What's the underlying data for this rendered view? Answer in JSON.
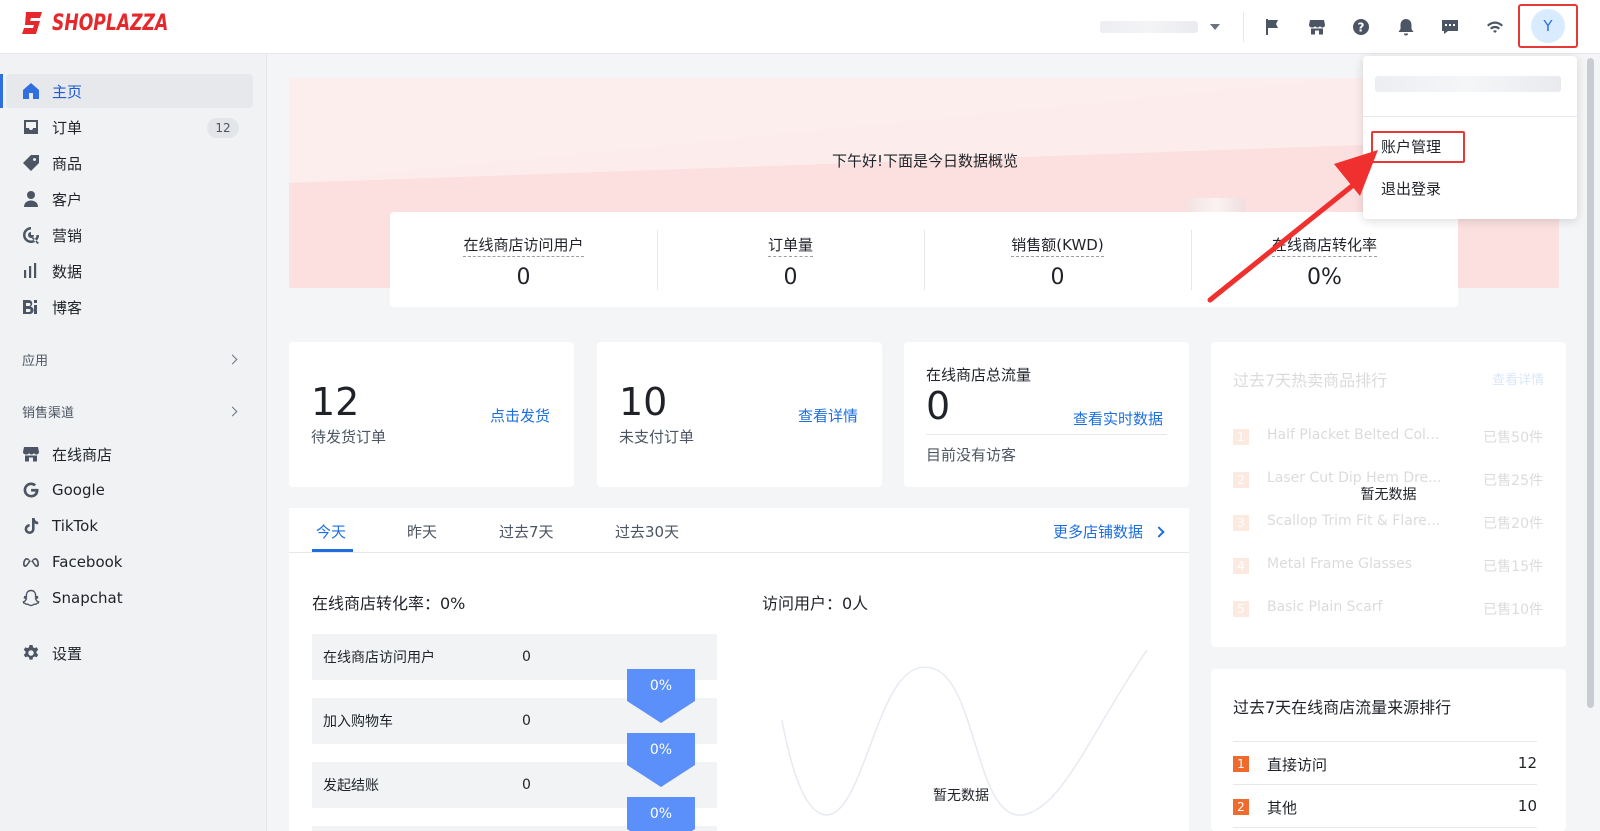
{
  "brand": {
    "name": "SHOPLAZZA",
    "color": "#e5282b"
  },
  "header": {
    "icons": [
      "flag-icon",
      "storefront-icon",
      "help-icon",
      "bell-icon",
      "message-icon",
      "wifi-icon"
    ],
    "avatar_letter": "Y"
  },
  "user_menu": {
    "items": [
      "账户管理",
      "退出登录"
    ],
    "highlighted": "账户管理"
  },
  "sidebar": {
    "items": [
      {
        "label": "主页",
        "icon": "home-icon",
        "active": true
      },
      {
        "label": "订单",
        "icon": "inbox-icon",
        "badge": "12"
      },
      {
        "label": "商品",
        "icon": "tag-icon"
      },
      {
        "label": "客户",
        "icon": "person-icon"
      },
      {
        "label": "营销",
        "icon": "marketing-icon"
      },
      {
        "label": "数据",
        "icon": "bar-chart-icon"
      },
      {
        "label": "博客",
        "icon": "blog-icon"
      }
    ],
    "apps_section": "应用",
    "channels_section": "销售渠道",
    "channels": [
      {
        "label": "在线商店",
        "icon": "store-icon"
      },
      {
        "label": "Google",
        "icon": "google-icon"
      },
      {
        "label": "TikTok",
        "icon": "tiktok-icon"
      },
      {
        "label": "Facebook",
        "icon": "meta-icon"
      },
      {
        "label": "Snapchat",
        "icon": "snapchat-icon"
      }
    ],
    "settings": {
      "label": "设置",
      "icon": "gear-icon"
    }
  },
  "banner": {
    "greeting": "下午好!下面是今日数据概览",
    "stats": [
      {
        "label": "在线商店访问用户",
        "value": "0"
      },
      {
        "label": "订单量",
        "value": "0"
      },
      {
        "label": "销售额(KWD)",
        "value": "0"
      },
      {
        "label": "在线商店转化率",
        "value": "0%"
      }
    ]
  },
  "cards": {
    "pending": {
      "value": "12",
      "label": "待发货订单",
      "link": "点击发货"
    },
    "unpaid": {
      "value": "10",
      "label": "未支付订单",
      "link": "查看详情"
    },
    "traffic": {
      "title": "在线商店总流量",
      "value": "0",
      "link": "查看实时数据",
      "note": "目前没有访客"
    }
  },
  "tabs": {
    "items": [
      "今天",
      "昨天",
      "过去7天",
      "过去30天"
    ],
    "more": "更多店铺数据"
  },
  "conversion": {
    "title": "在线商店转化率：0%",
    "funnel": [
      {
        "label": "在线商店访问用户",
        "value": "0"
      },
      {
        "label": "加入购物车",
        "value": "0"
      },
      {
        "label": "发起结账",
        "value": "0"
      }
    ],
    "arrows": [
      "0%",
      "0%",
      "0%"
    ]
  },
  "visitors": {
    "title": "访问用户：0人",
    "empty": "暂无数据"
  },
  "hot_products": {
    "title": "过去7天热卖商品排行",
    "link": "查看详情",
    "empty": "暂无数据",
    "items": [
      {
        "rank": "1",
        "name": "Half Placket Belted Col...",
        "sold": "已售50件"
      },
      {
        "rank": "2",
        "name": "Laser Cut Dip Hem Dre...",
        "sold": "已售25件"
      },
      {
        "rank": "3",
        "name": "Scallop Trim Fit & Flare...",
        "sold": "已售20件"
      },
      {
        "rank": "4",
        "name": "Metal Frame Glasses",
        "sold": "已售15件"
      },
      {
        "rank": "5",
        "name": "Basic Plain Scarf",
        "sold": "已售10件"
      }
    ]
  },
  "traffic_sources": {
    "title": "过去7天在线商店流量来源排行",
    "items": [
      {
        "rank": "1",
        "name": "直接访问",
        "count": "12"
      },
      {
        "rank": "2",
        "name": "其他",
        "count": "10"
      }
    ]
  }
}
